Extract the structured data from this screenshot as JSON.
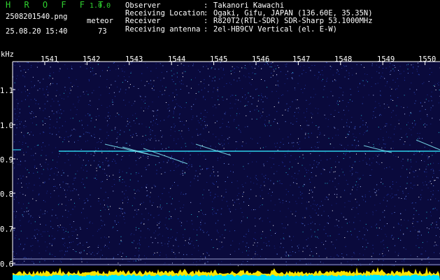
{
  "header": {
    "app_name": "H R O F F T",
    "version": "1.0.0",
    "filename": "2508201540.png",
    "mode_label": "meteor",
    "datetime": "25.08.20 15:40",
    "count": "73"
  },
  "info": [
    {
      "key": "Observer",
      "value": "Takanori Kawachi"
    },
    {
      "key": "Receiving Location",
      "value": "Ogaki, Gifu, JAPAN (136.60E, 35.35N)"
    },
    {
      "key": "Receiver",
      "value": "R820T2(RTL-SDR) SDR-Sharp 53.1000MHz"
    },
    {
      "key": "Receiving antenna",
      "value": "2el-HB9CV Vertical (el. E-W)"
    }
  ],
  "time_axis": [
    "1541",
    "1542",
    "1543",
    "1544",
    "1545",
    "1546",
    "1547",
    "1548",
    "1549",
    "1550"
  ],
  "freq_axis": {
    "unit": "kHz",
    "labels": [
      "1.1",
      "1.0",
      "0.9",
      "0.8",
      "0.7",
      "0.6"
    ]
  },
  "colors": {
    "background": "#000000",
    "spectrum_bg": "#0a0a3c",
    "signal": "#2cd0e8",
    "header_accent": "#2fd12f",
    "baseline_fill": "#00e5ff",
    "baseline_peak": "#ffe600"
  }
}
